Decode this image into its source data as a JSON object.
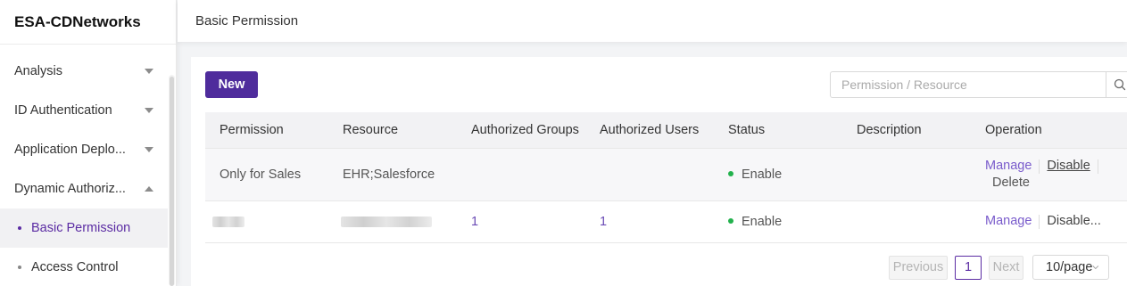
{
  "app": {
    "brand": "ESA-CDNetworks"
  },
  "sidebar": {
    "items": [
      {
        "label": "Analysis",
        "expanded": false
      },
      {
        "label": "ID Authentication",
        "expanded": false
      },
      {
        "label": "Application Deplo...",
        "expanded": false
      },
      {
        "label": "Dynamic Authoriz...",
        "expanded": true
      }
    ],
    "sub_items": [
      {
        "label": "Basic Permission",
        "active": true
      },
      {
        "label": "Access Control",
        "active": false
      }
    ]
  },
  "header": {
    "title": "Basic Permission"
  },
  "toolbar": {
    "new_label": "New",
    "search_placeholder": "Permission / Resource",
    "search_icon": "search-icon"
  },
  "table": {
    "columns": [
      "Permission",
      "Resource",
      "Authorized Groups",
      "Authorized Users",
      "Status",
      "Description",
      "Operation"
    ],
    "rows": [
      {
        "permission": "Only for Sales",
        "resource": "EHR;Salesforce",
        "groups": "",
        "users": "",
        "status": "Enable",
        "description": "",
        "ops": {
          "manage": "Manage",
          "disable": "Disable",
          "delete": "Delete"
        }
      },
      {
        "permission": "",
        "resource": "",
        "groups": "1",
        "users": "1",
        "status": "Enable",
        "description": "",
        "ops": {
          "manage": "Manage",
          "disable": "Disable..."
        }
      }
    ]
  },
  "pagination": {
    "prev_label": "Previous",
    "page": "1",
    "next_label": "Next",
    "page_size": "10/page"
  },
  "colors": {
    "accent": "#4f2c9c",
    "link": "#7a5ccc",
    "status_enable": "#22b14c"
  }
}
